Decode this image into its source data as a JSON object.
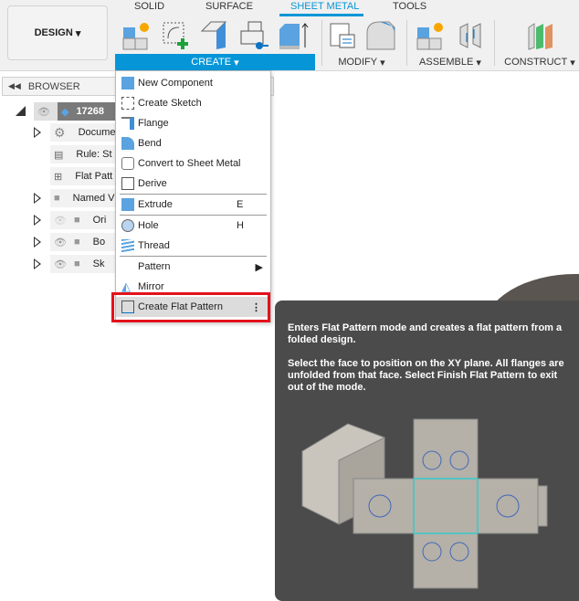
{
  "toolbar": {
    "design_label": "DESIGN",
    "tabs": [
      "SOLID",
      "SURFACE",
      "SHEET METAL",
      "TOOLS"
    ],
    "active_tab": "SHEET METAL",
    "groups": {
      "create": "CREATE",
      "modify": "MODIFY",
      "assemble": "ASSEMBLE",
      "construct": "CONSTRUCT"
    },
    "accent": "#0696d7"
  },
  "browser": {
    "title": "BROWSER",
    "root": "17268",
    "items": [
      "Docume",
      "Rule: St",
      "Flat Patt",
      "Named V",
      "Ori",
      "Bo",
      "Sk"
    ]
  },
  "menu": {
    "items": [
      {
        "label": "New Component"
      },
      {
        "label": "Create Sketch"
      },
      {
        "label": "Flange"
      },
      {
        "label": "Bend"
      },
      {
        "label": "Convert to Sheet Metal"
      },
      {
        "label": "Derive"
      },
      {
        "label": "Extrude",
        "shortcut": "E"
      },
      {
        "label": "Hole",
        "shortcut": "H"
      },
      {
        "label": "Thread"
      },
      {
        "label": "Pattern"
      },
      {
        "label": "Mirror"
      },
      {
        "label": "Create Flat Pattern"
      }
    ]
  },
  "tooltip": {
    "line1": "Enters Flat Pattern mode and creates a flat pattern from a folded design.",
    "line2": "Select the face to position on the XY plane. All flanges are unfolded from that face. Select Finish Flat Pattern to exit out of the mode."
  }
}
